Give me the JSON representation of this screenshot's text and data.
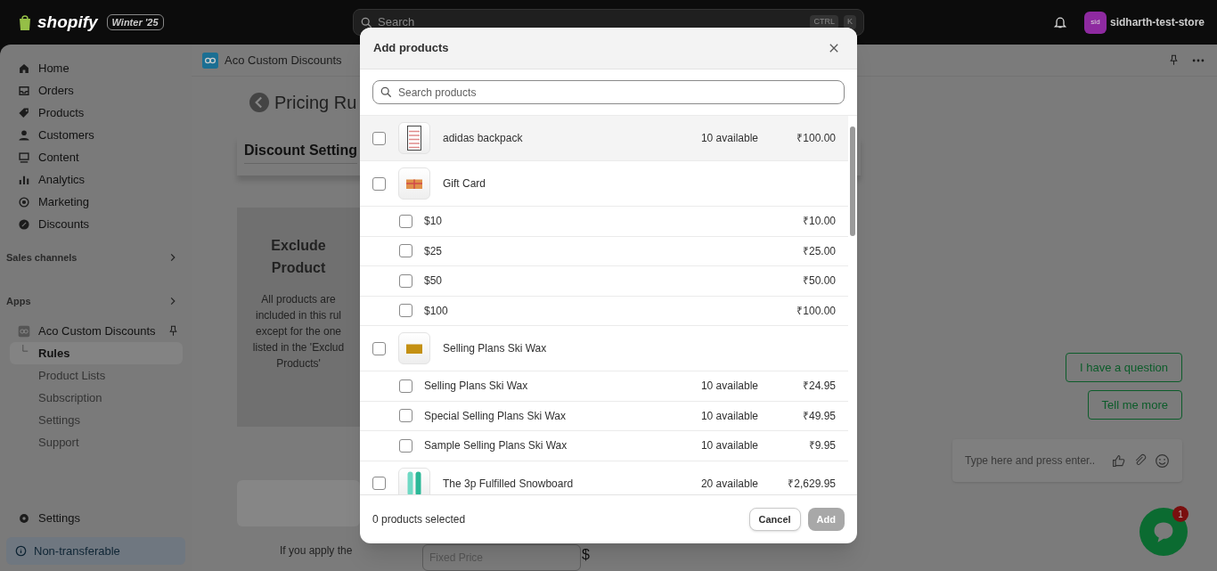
{
  "top_bar": {
    "logo": "shopify",
    "edition": "Winter '25",
    "search": {
      "placeholder": "Search",
      "shortcut": [
        "CTRL",
        "K"
      ]
    },
    "store": {
      "avatar": "sid",
      "name": "sidharth-test-store"
    }
  },
  "sidebar": {
    "items": [
      {
        "label": "Home"
      },
      {
        "label": "Orders"
      },
      {
        "label": "Products"
      },
      {
        "label": "Customers"
      },
      {
        "label": "Content"
      },
      {
        "label": "Analytics"
      },
      {
        "label": "Marketing"
      },
      {
        "label": "Discounts"
      }
    ],
    "sections": [
      {
        "label": "Sales channels"
      },
      {
        "label": "Apps"
      }
    ],
    "app": {
      "name": "Aco Custom Discounts",
      "children": [
        {
          "label": "Rules",
          "selected": true
        },
        {
          "label": "Product Lists",
          "selected": false
        },
        {
          "label": "Subscription",
          "selected": false
        },
        {
          "label": "Settings",
          "selected": false
        },
        {
          "label": "Support",
          "selected": false
        }
      ]
    },
    "settings": "Settings",
    "notice": "Non-transferable"
  },
  "main": {
    "app_title": "Aco Custom Discounts",
    "page_title": "Pricing Ru",
    "section_title": "Discount Setting",
    "exclude_card": {
      "title": "Exclude Product",
      "lines": [
        "All products are",
        "included in this rul",
        "except for the one",
        "listed in the 'Exclud",
        "Products'"
      ]
    },
    "note": "If you apply the",
    "price_field": {
      "placeholder": "Fixed Price"
    },
    "currency": "$"
  },
  "chat": {
    "quick_replies": [
      "I have a question",
      "Tell me more"
    ],
    "input": {
      "placeholder": "Type here and press enter.."
    },
    "unread": "1"
  },
  "modal": {
    "title": "Add products",
    "search": {
      "placeholder": "Search products"
    },
    "rows": [
      {
        "kind": "product",
        "name": "adidas backpack",
        "available": "10 available",
        "price": "₹100.00",
        "checked": false
      },
      {
        "kind": "product",
        "name": "Gift Card",
        "checked": false
      },
      {
        "kind": "variant",
        "name": "$10",
        "price": "₹10.00",
        "checked": false
      },
      {
        "kind": "variant",
        "name": "$25",
        "price": "₹25.00",
        "checked": false
      },
      {
        "kind": "variant",
        "name": "$50",
        "price": "₹50.00",
        "checked": false
      },
      {
        "kind": "variant",
        "name": "$100",
        "price": "₹100.00",
        "checked": false
      },
      {
        "kind": "product",
        "name": "Selling Plans Ski Wax",
        "checked": false
      },
      {
        "kind": "variant",
        "name": "Selling Plans Ski Wax",
        "available": "10 available",
        "price": "₹24.95",
        "checked": false
      },
      {
        "kind": "variant",
        "name": "Special Selling Plans Ski Wax",
        "available": "10 available",
        "price": "₹49.95",
        "checked": false
      },
      {
        "kind": "variant",
        "name": "Sample Selling Plans Ski Wax",
        "available": "10 available",
        "price": "₹9.95",
        "checked": false
      },
      {
        "kind": "product",
        "name": "The 3p Fulfilled Snowboard",
        "available": "20 available",
        "price": "₹2,629.95",
        "checked": false
      }
    ],
    "selected_count": "0 products selected",
    "buttons": [
      {
        "label": "Cancel",
        "kind": "secondary",
        "disabled": false
      },
      {
        "label": "Add",
        "kind": "primary",
        "disabled": true
      }
    ]
  }
}
